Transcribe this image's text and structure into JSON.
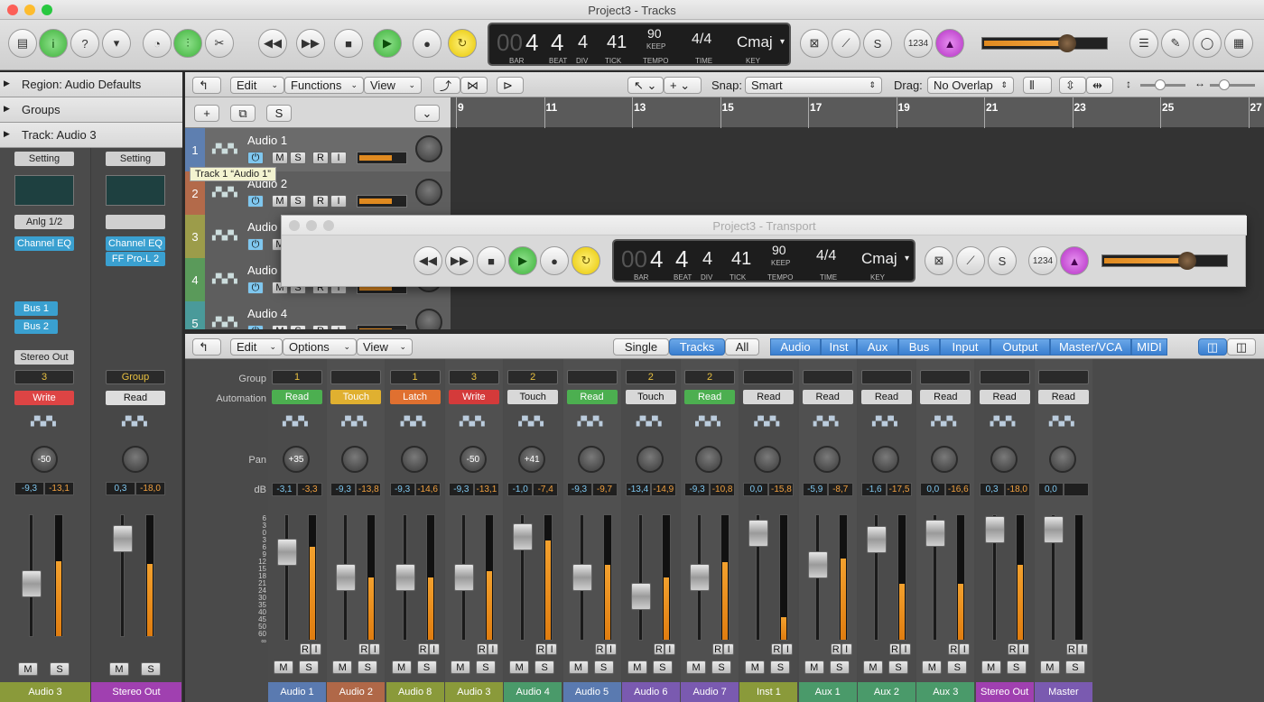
{
  "window": {
    "title": "Project3 - Tracks"
  },
  "transport_window": {
    "title": "Project3 - Transport"
  },
  "lcd": {
    "bar": "4",
    "beat": "4",
    "div": "4",
    "tick": "41",
    "tempo": "90",
    "tempo_mode": "KEEP",
    "time": "4/4",
    "key": "Cmaj",
    "bar_lbl": "BAR",
    "beat_lbl": "BEAT",
    "div_lbl": "DIV",
    "tick_lbl": "TICK",
    "tempo_lbl": "TEMPO",
    "time_lbl": "TIME",
    "key_lbl": "KEY"
  },
  "counter": "1234",
  "inspector": {
    "region": "Region: Audio Defaults",
    "groups": "Groups",
    "track": "Track:  Audio 3"
  },
  "tracks_bar": {
    "edit": "Edit",
    "functions": "Functions",
    "view": "View",
    "snap_label": "Snap:",
    "snap": "Smart",
    "drag_label": "Drag:",
    "drag": "No Overlap"
  },
  "ruler": [
    "9",
    "11",
    "13",
    "15",
    "17",
    "19",
    "21",
    "23",
    "25",
    "27"
  ],
  "tracks": [
    {
      "num": "1",
      "name": "Audio 1",
      "color": "#5e7fb0"
    },
    {
      "num": "2",
      "name": "Audio 2",
      "color": "#b36a4a"
    },
    {
      "num": "3",
      "name": "Audio 3",
      "color": "#9c9c4a"
    },
    {
      "num": "4",
      "name": "Audio 3",
      "color": "#5a9a5a"
    },
    {
      "num": "5",
      "name": "Audio 4",
      "color": "#4a9a9a"
    }
  ],
  "tooltip": "Track 1 “Audio 1”",
  "left_strips": [
    {
      "setting": "Setting",
      "input": "Anlg 1/2",
      "plugins": [
        "Channel EQ"
      ],
      "sends": [
        "Bus 1",
        "Bus 2"
      ],
      "output": "Stereo Out",
      "group": "3",
      "automation": "Write",
      "auto_color": "#d44",
      "pan": "-50",
      "db1": "-9,3",
      "db2": "-13,1",
      "name": "Audio 3",
      "name_color": "#8a9a3a"
    },
    {
      "setting": "Setting",
      "input": "",
      "plugins": [
        "Channel EQ",
        "FF Pro-L 2"
      ],
      "sends": [],
      "output": "",
      "group": "Group",
      "automation": "Read",
      "auto_color": "#ddd",
      "pan": "",
      "db1": "0,3",
      "db2": "-18,0",
      "name": "Stereo Out",
      "name_color": "#a040b0"
    }
  ],
  "mixer_bar": {
    "edit": "Edit",
    "options": "Options",
    "view": "View",
    "single": "Single",
    "tracks": "Tracks",
    "all": "All",
    "filters": [
      "Audio",
      "Inst",
      "Aux",
      "Bus",
      "Input",
      "Output",
      "Master/VCA",
      "MIDI"
    ]
  },
  "mixer_labels": {
    "group": "Group",
    "automation": "Automation",
    "pan": "Pan",
    "db": "dB"
  },
  "scale": [
    "6",
    "3",
    "0",
    "3",
    "6",
    "9",
    "12",
    "15",
    "18",
    "21",
    "24",
    "30",
    "35",
    "40",
    "45",
    "50",
    "60",
    "∞"
  ],
  "strips": [
    {
      "group": "1",
      "automation": "Read",
      "auto": "green",
      "pan": "+35",
      "db1": "-3,1",
      "db2": "-3,3",
      "fader": 0.3,
      "meter": 0.75,
      "name": "Audio 1",
      "color": "#5a7ab0"
    },
    {
      "group": "",
      "automation": "Touch",
      "auto": "yellow",
      "pan": "",
      "db1": "-9,3",
      "db2": "-13,8",
      "fader": 0.5,
      "meter": 0.5,
      "name": "Audio 2",
      "color": "#b06848"
    },
    {
      "group": "1",
      "automation": "Latch",
      "auto": "orange",
      "pan": "",
      "db1": "-9,3",
      "db2": "-14,6",
      "fader": 0.5,
      "meter": 0.5,
      "name": "Audio 8",
      "color": "#8a9a3a"
    },
    {
      "group": "3",
      "automation": "Write",
      "auto": "red",
      "pan": "-50",
      "db1": "-9,3",
      "db2": "-13,1",
      "fader": 0.5,
      "meter": 0.55,
      "name": "Audio 3",
      "color": "#8a9a3a"
    },
    {
      "group": "2",
      "automation": "Touch",
      "auto": "none",
      "pan": "+41",
      "db1": "-1,0",
      "db2": "-7,4",
      "fader": 0.18,
      "meter": 0.8,
      "name": "Audio 4",
      "color": "#4a9a6a"
    },
    {
      "group": "",
      "automation": "Read",
      "auto": "green",
      "pan": "",
      "db1": "-9,3",
      "db2": "-9,7",
      "fader": 0.5,
      "meter": 0.6,
      "name": "Audio 5",
      "color": "#5a7ab0"
    },
    {
      "group": "2",
      "automation": "Touch",
      "auto": "none",
      "pan": "",
      "db1": "-13,4",
      "db2": "-14,9",
      "fader": 0.65,
      "meter": 0.5,
      "name": "Audio 6",
      "color": "#7a5ab0"
    },
    {
      "group": "2",
      "automation": "Read",
      "auto": "green",
      "pan": "",
      "db1": "-9,3",
      "db2": "-10,8",
      "fader": 0.5,
      "meter": 0.62,
      "name": "Audio 7",
      "color": "#7a5ab0"
    },
    {
      "group": "",
      "automation": "Read",
      "auto": "none",
      "pan": "",
      "db1": "0,0",
      "db2": "-15,8",
      "fader": 0.15,
      "meter": 0.18,
      "name": "Inst 1",
      "color": "#8a9a3a"
    },
    {
      "group": "",
      "automation": "Read",
      "auto": "none",
      "pan": "",
      "db1": "-5,9",
      "db2": "-8,7",
      "fader": 0.4,
      "meter": 0.65,
      "name": "Aux 1",
      "color": "#4a9a6a"
    },
    {
      "group": "",
      "automation": "Read",
      "auto": "none",
      "pan": "",
      "db1": "-1,6",
      "db2": "-17,5",
      "fader": 0.2,
      "meter": 0.45,
      "name": "Aux 2",
      "color": "#4a9a6a"
    },
    {
      "group": "",
      "automation": "Read",
      "auto": "none",
      "pan": "",
      "db1": "0,0",
      "db2": "-16,6",
      "fader": 0.15,
      "meter": 0.45,
      "name": "Aux 3",
      "color": "#4a9a6a"
    },
    {
      "group": "",
      "automation": "Read",
      "auto": "none",
      "pan": "",
      "db1": "0,3",
      "db2": "-18,0",
      "fader": 0.12,
      "meter": 0.6,
      "name": "Stereo Out",
      "color": "#a040b0"
    },
    {
      "group": "",
      "automation": "Read",
      "auto": "none",
      "pan": "",
      "db1": "0,0",
      "db2": "",
      "fader": 0.12,
      "meter": 0.0,
      "name": "Master",
      "color": "#7a5ab0"
    }
  ],
  "colors": {
    "green": "#4caf50",
    "yellow": "#e0b030",
    "orange": "#e07030",
    "red": "#d43a3a",
    "none": "#d8d8d8"
  }
}
